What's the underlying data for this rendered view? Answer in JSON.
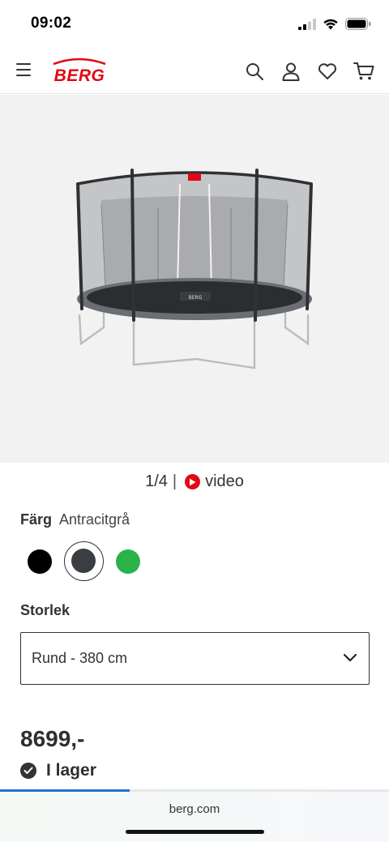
{
  "status_bar": {
    "time": "09:02"
  },
  "header": {
    "logo_text": "BERG",
    "brand_color": "#e30613",
    "icons": [
      "menu-icon",
      "search-icon",
      "account-icon",
      "heart-icon",
      "cart-icon"
    ]
  },
  "gallery": {
    "counter": "1/4",
    "separator": "|",
    "video_label": "video",
    "video_icon_color": "#e30613"
  },
  "color": {
    "label": "Färg",
    "value": "Antracitgrå",
    "options": [
      {
        "name": "black",
        "hex": "#000000",
        "selected": false
      },
      {
        "name": "antracitgra",
        "hex": "#3a3d42",
        "selected": true
      },
      {
        "name": "green",
        "hex": "#2bb34a",
        "selected": false
      }
    ]
  },
  "size": {
    "label": "Storlek",
    "selected": "Rund - 380 cm"
  },
  "product": {
    "price": "8699,-",
    "stock_label": "I lager"
  },
  "page_scroll_progress": 0.333,
  "browser": {
    "url": "berg.com"
  }
}
